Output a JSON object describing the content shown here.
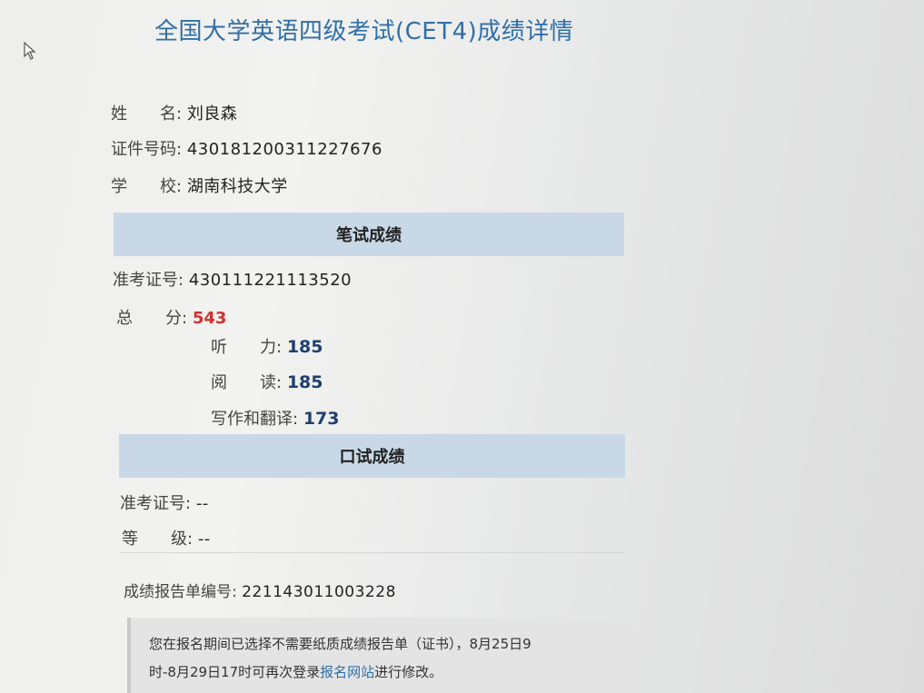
{
  "title": "全国大学英语四级考试(CET4)成绩详情",
  "personal": {
    "name_label": "姓　　名:",
    "name": "刘良森",
    "id_label": "证件号码:",
    "id": "430181200311227676",
    "school_label": "学　　校:",
    "school": "湖南科技大学"
  },
  "written": {
    "header": "笔试成绩",
    "ticket_label": "准考证号:",
    "ticket": "430111221113520",
    "total_label": "总　　分:",
    "total": "543",
    "listening_label": "听　　力:",
    "listening": "185",
    "reading_label": "阅　　读:",
    "reading": "185",
    "writing_label": "写作和翻译:",
    "writing": "173"
  },
  "oral": {
    "header": "口试成绩",
    "ticket_label": "准考证号:",
    "ticket": "--",
    "grade_label": "等　　级:",
    "grade": "--"
  },
  "report": {
    "label": "成绩报告单编号:",
    "number": "221143011003228"
  },
  "notice": {
    "line1": "您在报名期间已选择不需要纸质成绩报告单（证书），8月25日9",
    "line2_before": "时-8月29日17时可再次登录",
    "link": "报名网站",
    "line2_after": "进行修改。"
  }
}
